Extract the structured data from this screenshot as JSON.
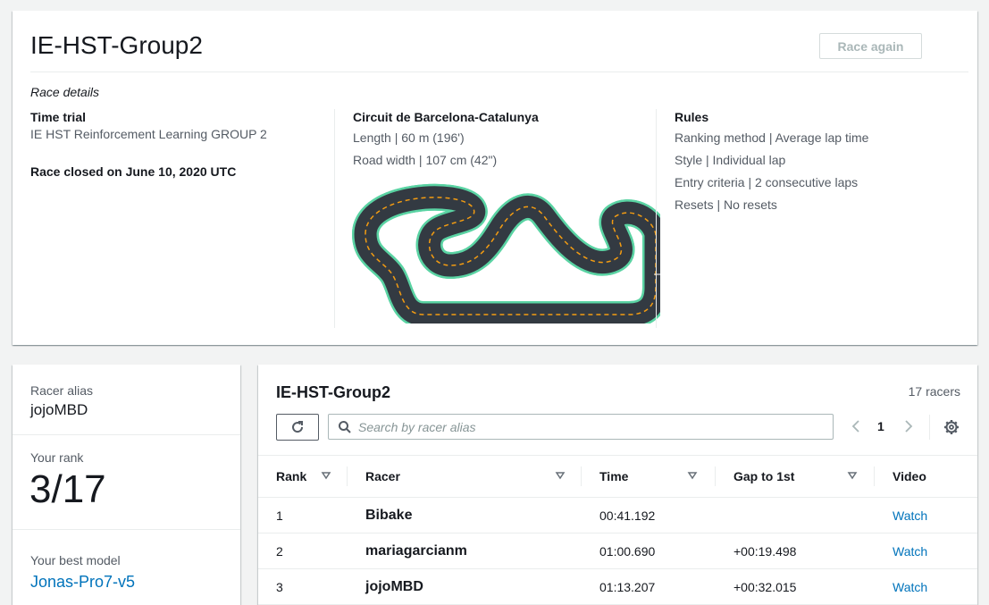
{
  "race": {
    "title": "IE-HST-Group2",
    "race_again_label": "Race again",
    "details_label": "Race details",
    "type": "Time trial",
    "description": "IE HST Reinforcement Learning GROUP 2",
    "closed": "Race closed on June 10, 2020 UTC",
    "track": {
      "name": "Circuit de Barcelona-Catalunya",
      "length": "Length | 60 m (196')",
      "width": "Road width | 107 cm (42\")"
    },
    "rules": {
      "heading": "Rules",
      "items": [
        "Ranking method | Average lap time",
        "Style | Individual lap",
        "Entry criteria | 2 consecutive laps",
        "Resets | No resets"
      ]
    },
    "colors": {
      "track": "#333a42",
      "track_edge": "#5ad3a3",
      "centerline": "#f39c12"
    }
  },
  "profile": {
    "alias_label": "Racer alias",
    "alias": "jojoMBD",
    "rank_label": "Your rank",
    "rank": "3/17",
    "model_label": "Your best model",
    "model": "Jonas-Pro7-v5"
  },
  "leaderboard": {
    "title": "IE-HST-Group2",
    "count": "17 racers",
    "search_placeholder": "Search by racer alias",
    "page": "1",
    "columns": [
      "Rank",
      "Racer",
      "Time",
      "Gap to 1st",
      "Video"
    ],
    "rows": [
      {
        "rank": "1",
        "racer": "Bibake",
        "time": "00:41.192",
        "gap": "",
        "video": "Watch"
      },
      {
        "rank": "2",
        "racer": "mariagarcianm",
        "time": "01:00.690",
        "gap": "+00:19.498",
        "video": "Watch"
      },
      {
        "rank": "3",
        "racer": "jojoMBD",
        "time": "01:13.207",
        "gap": "+00:32.015",
        "video": "Watch"
      }
    ],
    "icons": [
      "refresh-icon",
      "search-icon",
      "chevron-left-icon",
      "chevron-right-icon",
      "gear-icon",
      "sort-icon"
    ]
  }
}
